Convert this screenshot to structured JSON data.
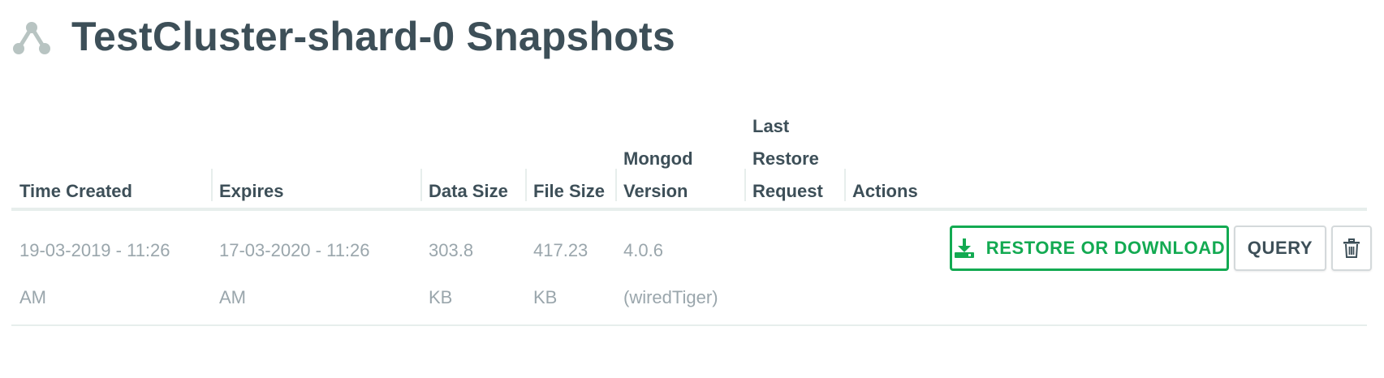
{
  "header": {
    "title": "TestCluster-shard-0 Snapshots",
    "icon": "replica-set-icon"
  },
  "table": {
    "columns": [
      {
        "key": "time_created",
        "lines": [
          "Time Created"
        ]
      },
      {
        "key": "expires",
        "lines": [
          "Expires"
        ]
      },
      {
        "key": "data_size",
        "lines": [
          "Data Size"
        ]
      },
      {
        "key": "file_size",
        "lines": [
          "File Size"
        ]
      },
      {
        "key": "mongod_version",
        "lines": [
          "Mongod",
          "Version"
        ]
      },
      {
        "key": "last_restore_request",
        "lines": [
          "Last",
          "Restore",
          "Request"
        ]
      },
      {
        "key": "actions",
        "lines": [
          "Actions"
        ]
      }
    ],
    "rows": [
      {
        "time_created": [
          "19-03-2019 - 11:26",
          "AM"
        ],
        "expires": [
          "17-03-2020 - 11:26",
          "AM"
        ],
        "data_size": [
          "303.8",
          "KB"
        ],
        "file_size": [
          "417.23",
          "KB"
        ],
        "mongod_version": [
          "4.0.6",
          "(wiredTiger)"
        ],
        "last_restore_request": [],
        "actions": {
          "restore_label": "RESTORE OR DOWNLOAD",
          "query_label": "QUERY",
          "delete_icon": "trash-icon"
        }
      }
    ]
  },
  "colors": {
    "text_dark": "#3d4f58",
    "text_muted": "#9aa6ac",
    "accent_green": "#13aa52",
    "border": "#e7eeec"
  }
}
